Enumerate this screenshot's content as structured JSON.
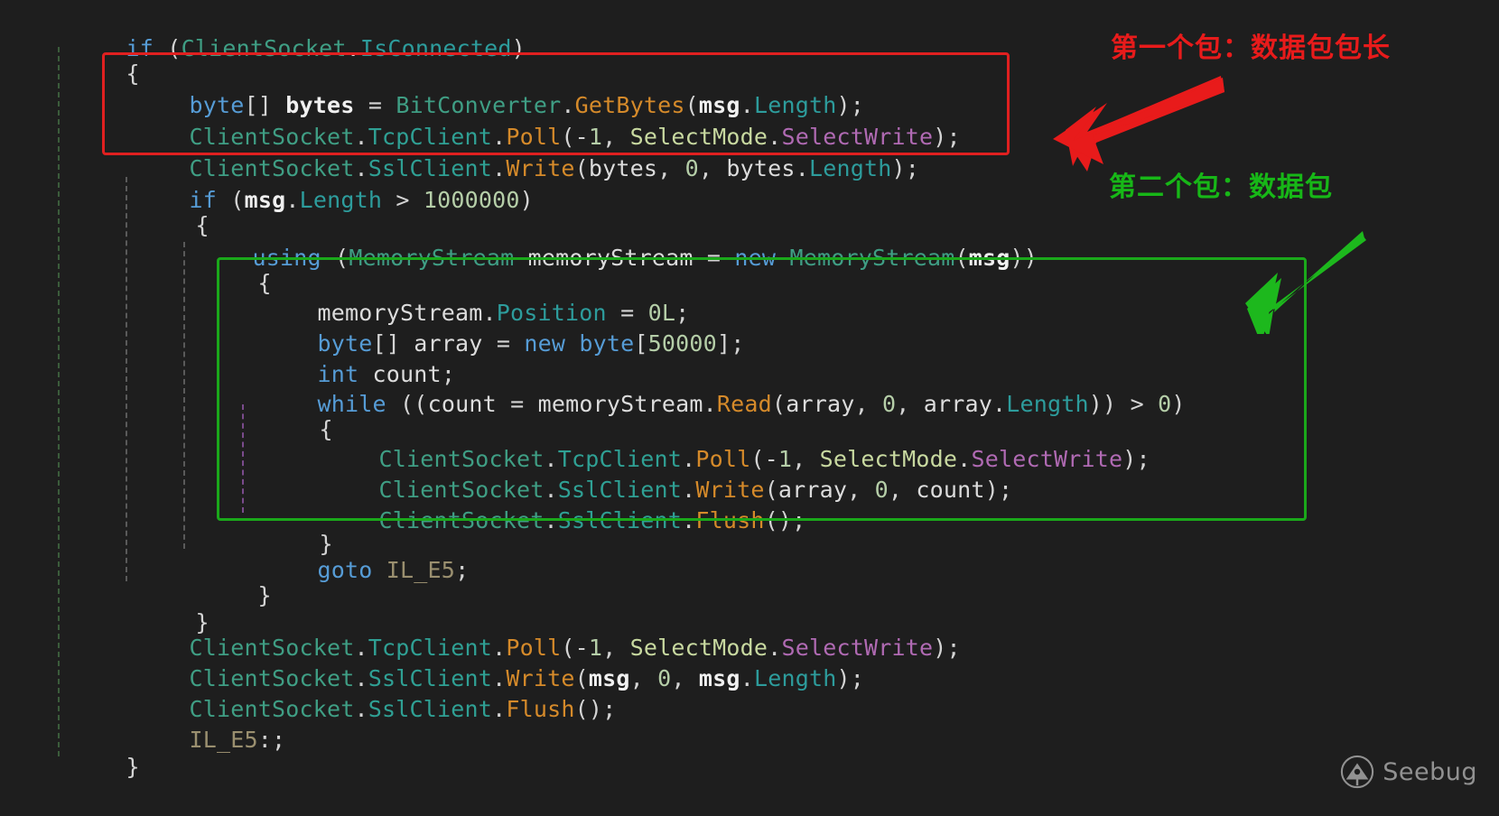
{
  "editor": {
    "background": "#1e1e1e",
    "font_size_px": 25,
    "line_height_px": 36,
    "colors": {
      "keyword": "#569cd6",
      "type": "#3f9e84",
      "member": "#2d9c9c",
      "method": "#d58a2a",
      "number": "#b5cea8",
      "enum_type": "#c8d9a0",
      "enum_value": "#b06ab3",
      "label": "#9a8f6f",
      "plain": "#dcdcdc"
    },
    "lines": [
      {
        "text": "if (ClientSocket.IsConnected)"
      },
      {
        "text": "{"
      },
      {
        "text": "    byte[] bytes = BitConverter.GetBytes(msg.Length);"
      },
      {
        "text": "    ClientSocket.TcpClient.Poll(-1, SelectMode.SelectWrite);"
      },
      {
        "text": "    ClientSocket.SslClient.Write(bytes, 0, bytes.Length);"
      },
      {
        "text": "    if (msg.Length > 1000000)"
      },
      {
        "text": "    {"
      },
      {
        "text": "        using (MemoryStream memoryStream = new MemoryStream(msg))"
      },
      {
        "text": "        {"
      },
      {
        "text": "            memoryStream.Position = 0L;"
      },
      {
        "text": "            byte[] array = new byte[50000];"
      },
      {
        "text": "            int count;"
      },
      {
        "text": "            while ((count = memoryStream.Read(array, 0, array.Length)) > 0)"
      },
      {
        "text": "            {"
      },
      {
        "text": "                ClientSocket.TcpClient.Poll(-1, SelectMode.SelectWrite);"
      },
      {
        "text": "                ClientSocket.SslClient.Write(array, 0, count);"
      },
      {
        "text": "                ClientSocket.SslClient.Flush();"
      },
      {
        "text": "            }"
      },
      {
        "text": "            goto IL_E5;"
      },
      {
        "text": "        }"
      },
      {
        "text": "    }"
      },
      {
        "text": "    ClientSocket.TcpClient.Poll(-1, SelectMode.SelectWrite);"
      },
      {
        "text": "    ClientSocket.SslClient.Write(msg, 0, msg.Length);"
      },
      {
        "text": "    ClientSocket.SslClient.Flush();"
      },
      {
        "text": "    IL_E5:;"
      },
      {
        "text": "}"
      }
    ]
  },
  "annotations": [
    {
      "id": "first-packet",
      "text": "第一个包：数据包包长",
      "color": "#e81b1b",
      "arrow": "down-left",
      "targets_box": "red-highlight-box"
    },
    {
      "id": "second-packet",
      "text": "第二个包：数据包",
      "color": "#17b717",
      "arrow": "down-left",
      "targets_box": "green-highlight-box"
    }
  ],
  "highlight_boxes": [
    {
      "id": "red-highlight-box",
      "color": "#e02020"
    },
    {
      "id": "green-highlight-box",
      "color": "#1aa81a"
    }
  ],
  "watermark": {
    "brand": "Seebug",
    "icon": "seebug-logo-icon"
  }
}
